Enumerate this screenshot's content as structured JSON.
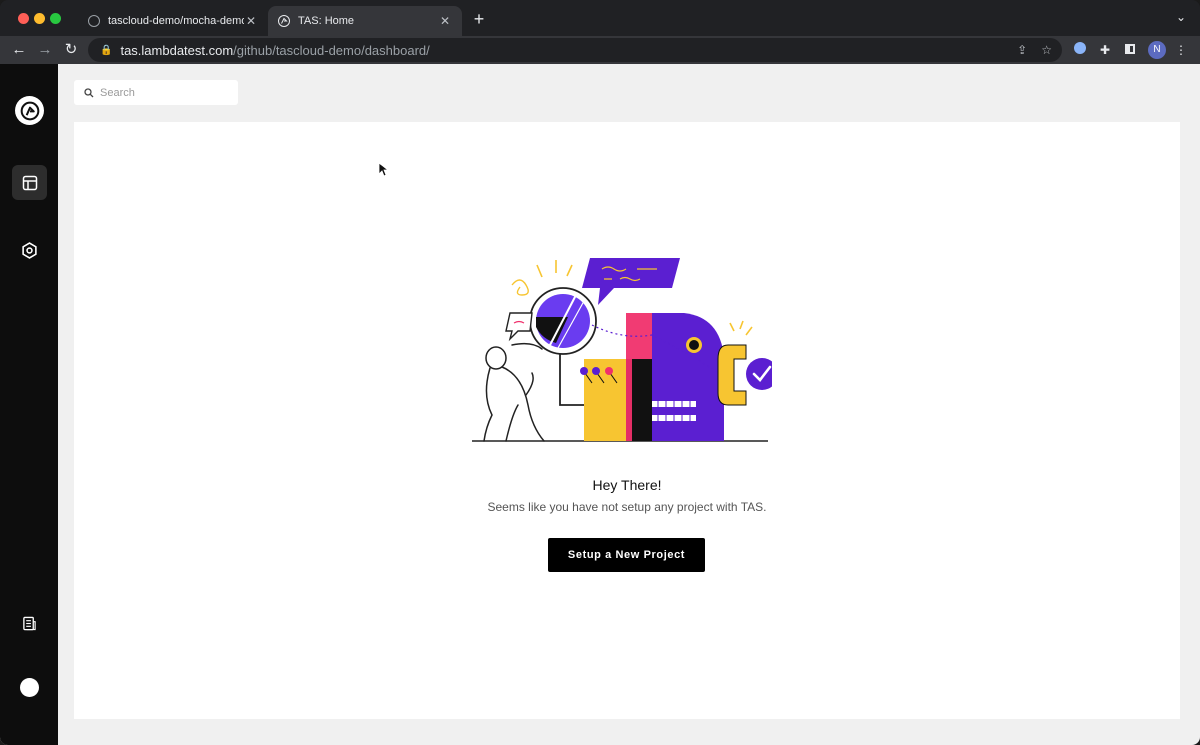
{
  "browser": {
    "tabs": [
      {
        "title": "tascloud-demo/mocha-demos",
        "active": false
      },
      {
        "title": "TAS: Home",
        "active": true
      }
    ],
    "url_host": "tas.lambdatest.com",
    "url_path": "/github/tascloud-demo/dashboard/",
    "profile_initial": "N"
  },
  "sidebar": {
    "items": [
      {
        "name": "logo"
      },
      {
        "name": "dashboard",
        "active": true
      },
      {
        "name": "settings"
      },
      {
        "name": "docs"
      },
      {
        "name": "user-avatar"
      }
    ]
  },
  "search": {
    "placeholder": "Search",
    "value": ""
  },
  "empty_state": {
    "heading": "Hey There!",
    "message": "Seems like you have not setup any project with TAS.",
    "cta_label": "Setup a New Project"
  },
  "colors": {
    "accent": "#000000",
    "purple": "#5b1fd1",
    "yellow": "#f7c531",
    "pink": "#f0306c"
  }
}
